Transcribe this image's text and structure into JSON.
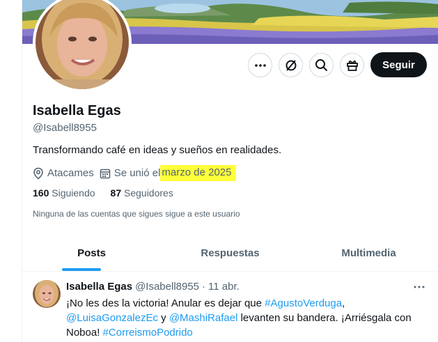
{
  "profile": {
    "name": "Isabella Egas",
    "handle": "@Isabell8955",
    "bio": "Transformando café en ideas y sueños en realidades.",
    "location": "Atacames",
    "joined_prefix": "Se unió el",
    "joined_date": "marzo de 2025",
    "following_count": "160",
    "following_label": "Siguiendo",
    "followers_count": "87",
    "followers_label": "Seguidores",
    "notice": "Ninguna de las cuentas que sigues sigue a este usuario"
  },
  "actions": {
    "more_icon": "more-dots-icon",
    "grok_icon": "grok-slash-icon",
    "search_icon": "search-icon",
    "gift_icon": "gift-icon",
    "follow_label": "Seguir"
  },
  "tabs": [
    {
      "label": "Posts",
      "active": true
    },
    {
      "label": "Respuestas",
      "active": false
    },
    {
      "label": "Multimedia",
      "active": false
    }
  ],
  "tweet": {
    "name": "Isabella Egas",
    "handle": "@Isabell8955",
    "separator": "·",
    "time": "11 abr.",
    "text_1": "¡No les des la victoria! Anular es dejar que ",
    "link_1": "#AgustoVerduga",
    "text_2": ",",
    "link_2": "@LuisaGonzalezEc",
    "text_3": " y ",
    "link_3": "@MashiRafael",
    "text_4": " levanten su bandera. ¡Arriésgala con Noboa! ",
    "link_4": "#CorreismoPodrido"
  },
  "colors": {
    "accent": "#1d9bf0",
    "highlight": "#ffff3a",
    "text_primary": "#0f1419",
    "text_secondary": "#536471"
  }
}
